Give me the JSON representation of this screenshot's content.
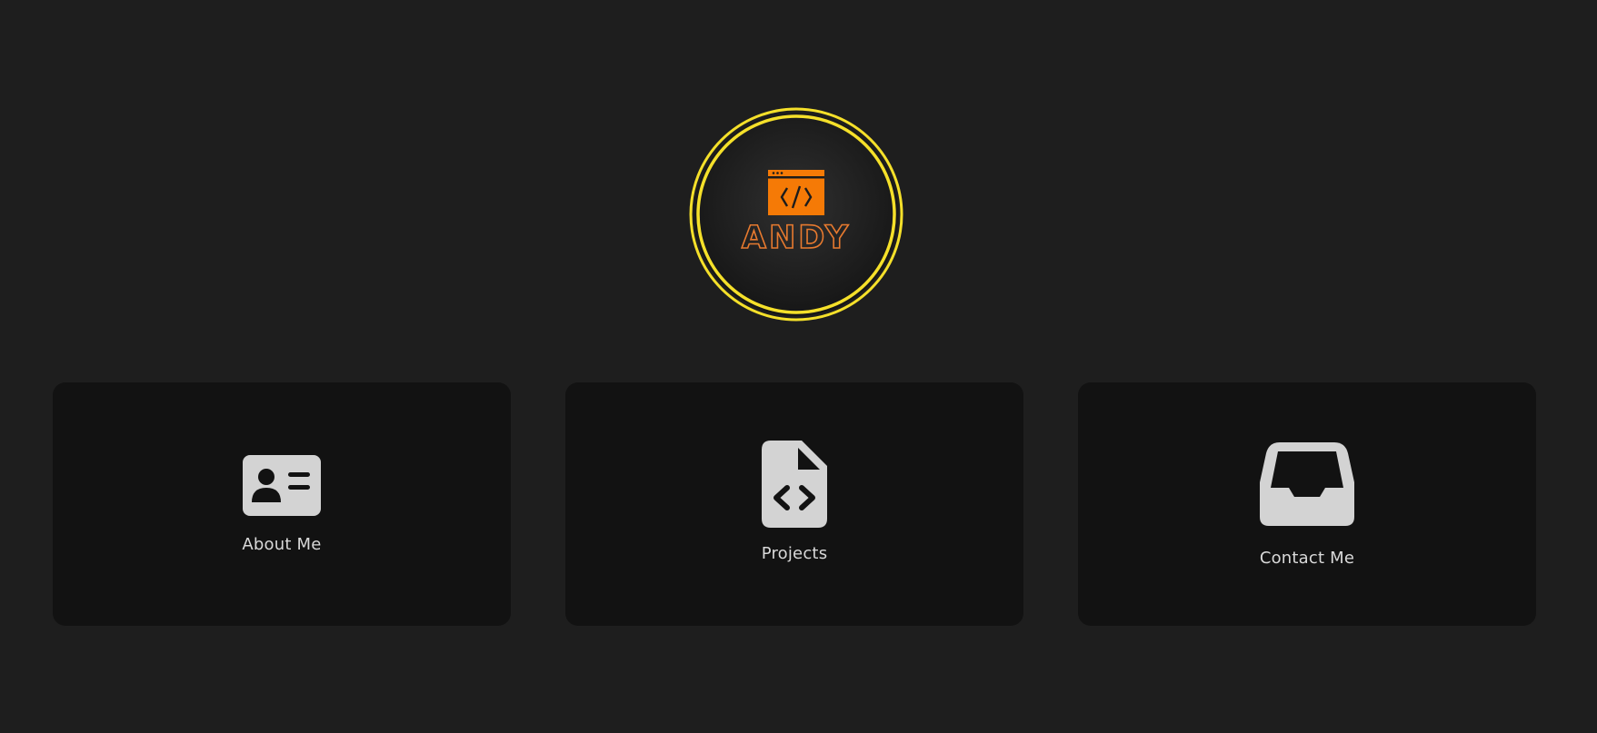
{
  "logo": {
    "name": "ANDY",
    "icon": "code-window-icon",
    "ring_color": "#f5e02a",
    "accent_color": "#f57a06",
    "text_color": "#e77a2f"
  },
  "cards": [
    {
      "label": "About Me",
      "icon": "id-card-icon"
    },
    {
      "label": "Projects",
      "icon": "file-code-icon"
    },
    {
      "label": "Contact Me",
      "icon": "inbox-icon"
    }
  ],
  "colors": {
    "background": "#1e1e1e",
    "card_background": "#121212",
    "icon_color": "#d3d3d3",
    "label_color": "#d9d9d9"
  }
}
